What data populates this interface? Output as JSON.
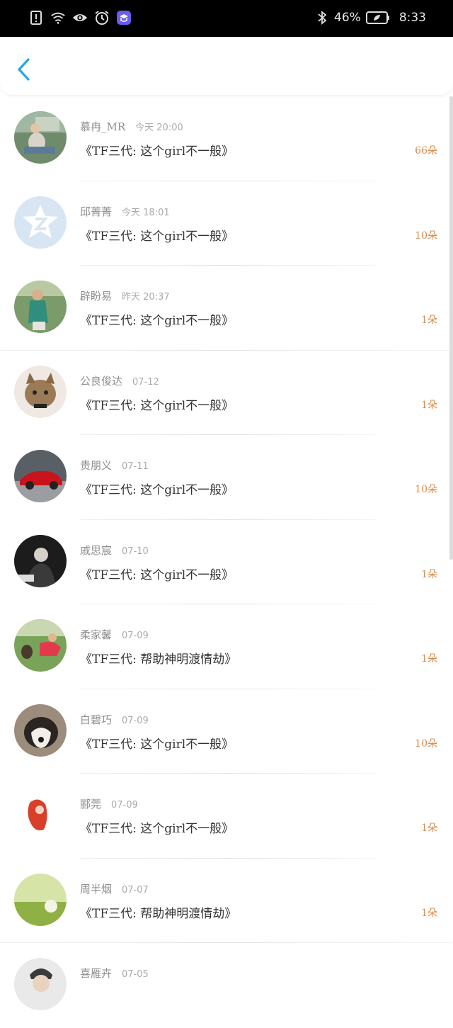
{
  "status_bar": {
    "battery": "46%",
    "time": "8:33",
    "left_icons": [
      "alert-icon",
      "wifi-icon",
      "eye-icon",
      "alarm-icon",
      "app-icon"
    ],
    "right_icons": [
      "bluetooth-icon",
      "battery-icon"
    ]
  },
  "header": {
    "back_icon": "chevron-left-icon",
    "accent": "#2aa3e6"
  },
  "colors": {
    "count": "#d98c50",
    "name": "#8e8e8e",
    "title": "#333333"
  },
  "rows": [
    {
      "name": "慕冉_MR",
      "time": "今天  20:00",
      "title": "《TF三代: 这个girl不一般》",
      "count": "66朵",
      "avatar": "photo-girl-car"
    },
    {
      "name": "邱菁菁",
      "time": "今天  18:01",
      "title": "《TF三代: 这个girl不一般》",
      "count": "10朵",
      "avatar": "qzone-default"
    },
    {
      "name": "辟盼易",
      "time": "昨天  20:37",
      "title": "《TF三代: 这个girl不一般》",
      "count": "1朵",
      "avatar": "photo-girl-green"
    },
    {
      "name": "公良俊达",
      "time": "07-12",
      "title": "《TF三代: 这个girl不一般》",
      "count": "1朵",
      "avatar": "photo-kitten"
    },
    {
      "name": "贵朋义",
      "time": "07-11",
      "title": "《TF三代: 这个girl不一般》",
      "count": "10朵",
      "avatar": "photo-red-car"
    },
    {
      "name": "戚思宸",
      "time": "07-10",
      "title": "《TF三代: 这个girl不一般》",
      "count": "1朵",
      "avatar": "photo-man-dark"
    },
    {
      "name": "柔家馨",
      "time": "07-09",
      "title": "《TF三代: 帮助神明渡情劫》",
      "count": "1朵",
      "avatar": "photo-kid-dog"
    },
    {
      "name": "白碧巧",
      "time": "07-09",
      "title": "《TF三代: 这个girl不一般》",
      "count": "10朵",
      "avatar": "photo-husky"
    },
    {
      "name": "郦莞",
      "time": "07-09",
      "title": "《TF三代: 这个girl不一般》",
      "count": "1朵",
      "avatar": "drawing-red-hair"
    },
    {
      "name": "周半烟",
      "time": "07-07",
      "title": "《TF三代: 帮助神明渡情劫》",
      "count": "1朵",
      "avatar": "photo-dandelion"
    },
    {
      "name": "喜雁卉",
      "time": "07-05",
      "title": "",
      "count": "",
      "avatar": "photo-man-white"
    }
  ]
}
